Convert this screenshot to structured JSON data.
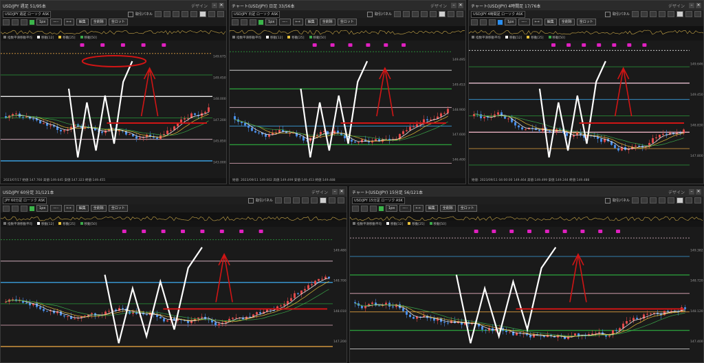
{
  "common": {
    "toolbar_labels": [
      "取引パネル"
    ],
    "design_label": "デザイン",
    "edit_label": "編集",
    "delete_all_label": "全削除",
    "wide_label": "全ロット",
    "width_label": "1px",
    "legend": [
      {
        "label": "指数平滑移動平均",
        "color": "#777777"
      },
      {
        "label": "移動[12]",
        "color": "#ffffff"
      },
      {
        "label": "移動[25]",
        "color": "#e8c23a"
      },
      {
        "label": "移動[50]",
        "color": "#3aa84a"
      }
    ],
    "colors": {
      "up": "#e04a4a",
      "down": "#4a8ee8",
      "annot": "#d11515",
      "white_line": "#ffffff",
      "marker": "#e020c0"
    }
  },
  "panels": [
    {
      "id": "p1",
      "title": "USD/JPY 週足 51/95本",
      "symbol": "USD/JPY 週足 ローソク ASK",
      "status": "2023/07/17   始値:147.760  高値:149.645  安値:147.323  終値:149.455",
      "price_labels": [
        "149.675",
        "149.450",
        "148.000",
        "147.200",
        "145.850",
        "143.000"
      ]
    },
    {
      "id": "p2",
      "title": "チャート(USD/JPY) 日足 33/56本",
      "symbol": "USD/JPY 日足 ローソク ASK",
      "status": "始値:   2023/09/11   149.002   高値:149.499   安値:149.453   終値:149.488",
      "price_labels": [
        "149.495",
        "149.453",
        "148.900",
        "147.600",
        "146.400"
      ]
    },
    {
      "id": "p3",
      "title": "チャート(USD/JPY) 4時間足 17/76本",
      "symbol": "USD/JPY 4時間足 ローソク ASK",
      "status": "始値:   2023/09/11 04:00:00   149.464   高値:149.499   安値:149.244   終値:149.488",
      "price_labels": [
        "149.646",
        "149.450",
        "148.830",
        "147.800"
      ]
    },
    {
      "id": "p4",
      "title": "USD/JPY 60分足 31/121本",
      "symbol": "JPY 60分足 ローソク ASK",
      "status": "",
      "price_labels": [
        "149.480",
        "148.700",
        "148.010",
        "147.200"
      ]
    },
    {
      "id": "p5",
      "title": "チャート(USD/JPY) 15分足 56/121本",
      "symbol": "USD/JPY 15分足 ローソク ASK",
      "status": "",
      "price_labels": [
        "149.382",
        "148.720",
        "148.120",
        "147.400"
      ]
    }
  ]
}
